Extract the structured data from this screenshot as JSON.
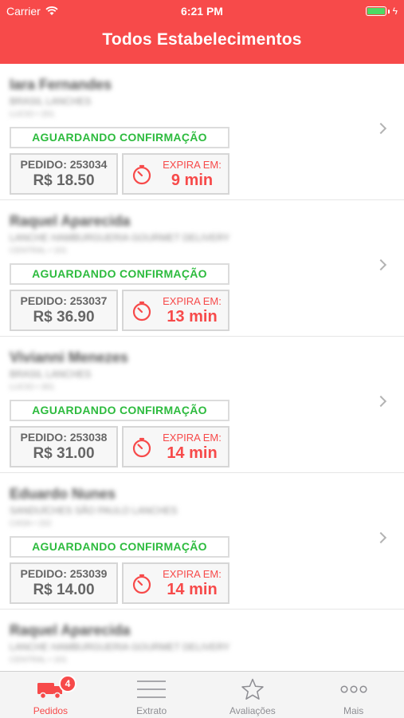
{
  "status_bar": {
    "carrier": "Carrier",
    "time": "6:21 PM"
  },
  "nav": {
    "title": "Todos Estabelecimentos"
  },
  "orders": [
    {
      "customer": "Iara Fernandes",
      "line1": "BRASIL LANCHES",
      "line2": "LUCIO • 201",
      "status": "AGUARDANDO CONFIRMAÇÃO",
      "pedido": "PEDIDO: 253034",
      "price": "R$ 18.50",
      "expira_label": "EXPIRA EM:",
      "expira_value": "9 min"
    },
    {
      "customer": "Raquel Aparecida",
      "line1": "LANCHE HAMBURGUERIA GOURMET DELIVERY",
      "line2": "CENTRAL • 101",
      "status": "AGUARDANDO CONFIRMAÇÃO",
      "pedido": "PEDIDO: 253037",
      "price": "R$ 36.90",
      "expira_label": "EXPIRA EM:",
      "expira_value": "13 min"
    },
    {
      "customer": "Vivianni Menezes",
      "line1": "BRASIL LANCHES",
      "line2": "LUCIO • 301",
      "status": "AGUARDANDO CONFIRMAÇÃO",
      "pedido": "PEDIDO: 253038",
      "price": "R$ 31.00",
      "expira_label": "EXPIRA EM:",
      "expira_value": "14 min"
    },
    {
      "customer": "Eduardo Nunes",
      "line1": "SANDUÍCHES SÃO PAULO LANCHES",
      "line2": "CASA • 152",
      "status": "AGUARDANDO CONFIRMAÇÃO",
      "pedido": "PEDIDO: 253039",
      "price": "R$ 14.00",
      "expira_label": "EXPIRA EM:",
      "expira_value": "14 min"
    },
    {
      "customer": "Raquel Aparecida",
      "line1": "LANCHE HAMBURGUERIA GOURMET DELIVERY",
      "line2": "CENTRAL • 101"
    }
  ],
  "tabs": [
    {
      "label": "Pedidos",
      "icon": "truck-icon",
      "badge": "4",
      "active": true
    },
    {
      "label": "Extrato",
      "icon": "menu-lines-icon"
    },
    {
      "label": "Avaliações",
      "icon": "star-icon"
    },
    {
      "label": "Mais",
      "icon": "more-dots-icon"
    }
  ],
  "colors": {
    "brand": "#f74a4a",
    "status_green": "#2dbb3e",
    "battery": "#4cd964"
  }
}
